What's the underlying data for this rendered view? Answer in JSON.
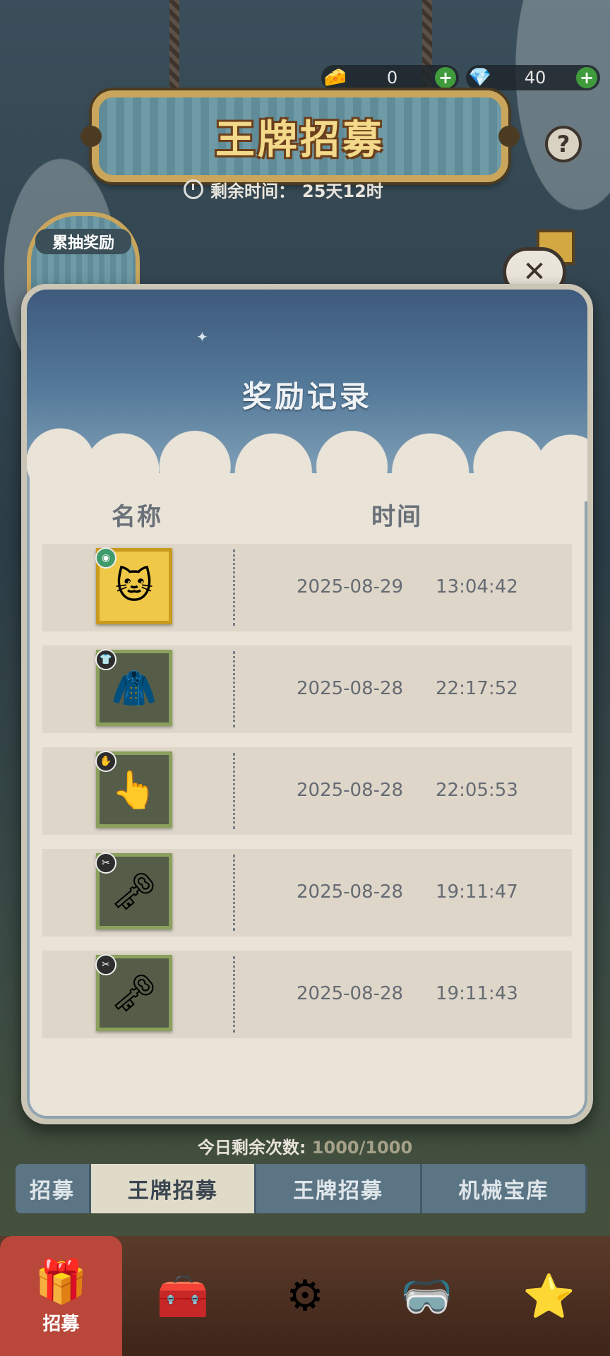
{
  "currency": {
    "cheese": {
      "icon": "cheese-icon",
      "value": "0"
    },
    "diamond": {
      "icon": "diamond-icon",
      "value": "40"
    },
    "plus_symbol": "+"
  },
  "header": {
    "title": "王牌招募",
    "timer_label": "剩余时间：",
    "timer_value": "25天12时",
    "help_symbol": "?"
  },
  "cumulative": {
    "label": "累抽奖励"
  },
  "close_symbol": "✕",
  "modal": {
    "title": "奖励记录",
    "col_name": "名称",
    "col_time": "时间",
    "records": [
      {
        "icon": "tom-character-card-icon",
        "tag": "s-rank-tag",
        "date": "2025-08-29",
        "time": "13:04:42"
      },
      {
        "icon": "jacket-costume-icon",
        "tag": "costume-tag",
        "date": "2025-08-28",
        "time": "22:17:52"
      },
      {
        "icon": "glove-hand-icon",
        "tag": "gesture-tag",
        "date": "2025-08-28",
        "time": "22:05:53"
      },
      {
        "icon": "windup-key-icon",
        "tag": "key-tag",
        "date": "2025-08-28",
        "time": "19:11:47"
      },
      {
        "icon": "windup-key-icon",
        "tag": "key-tag",
        "date": "2025-08-28",
        "time": "19:11:43"
      }
    ]
  },
  "remaining": {
    "label": "今日剩余次数:",
    "value": "1000/1000"
  },
  "tabs": [
    {
      "label": "招募",
      "active": false
    },
    {
      "label": "王牌招募",
      "active": true
    },
    {
      "label": "王牌招募",
      "active": false
    },
    {
      "label": "机械宝库",
      "active": false
    }
  ],
  "nav": {
    "items": [
      {
        "icon": "recruit-chest-icon",
        "label": "招募"
      },
      {
        "icon": "treasure-chest-icon",
        "label": ""
      },
      {
        "icon": "machine-icon",
        "label": ""
      },
      {
        "icon": "goggles-chest-icon",
        "label": ""
      },
      {
        "icon": "star-box-icon",
        "label": ""
      }
    ]
  }
}
